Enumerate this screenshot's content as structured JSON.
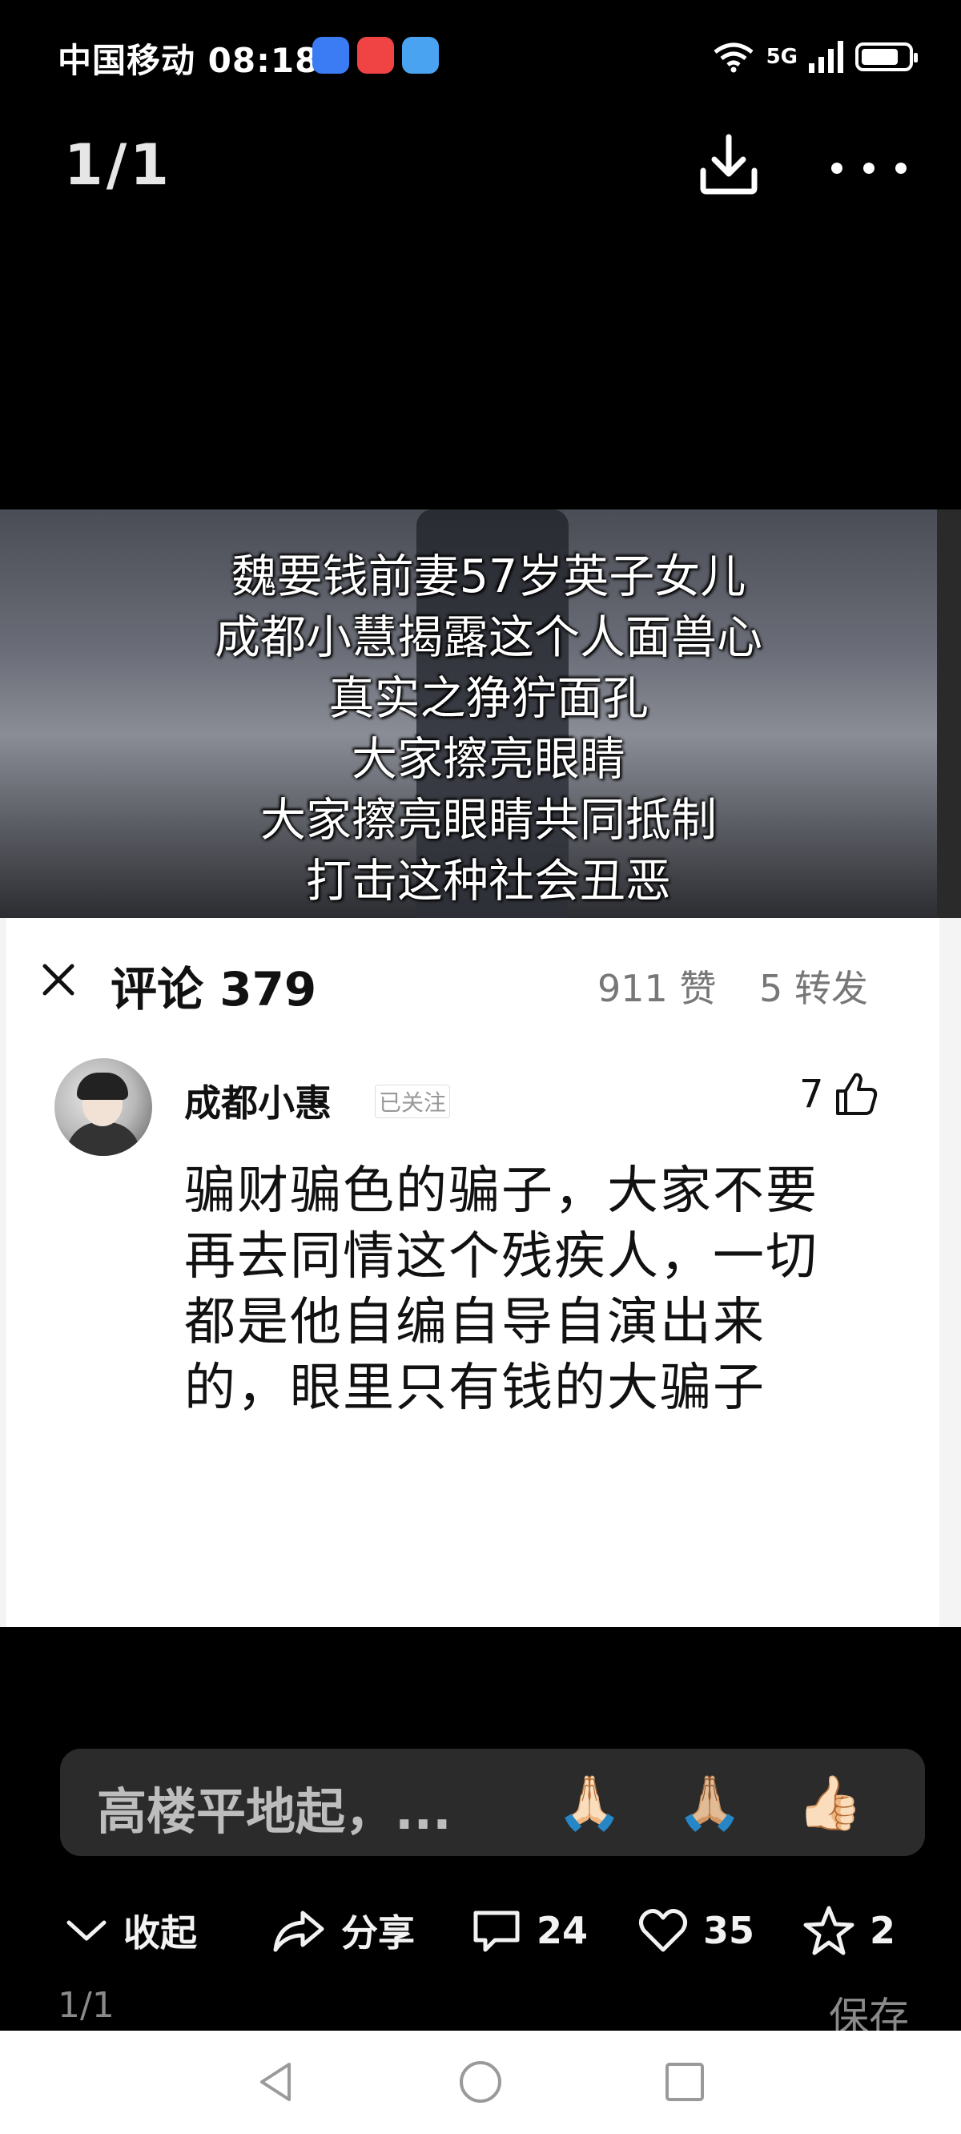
{
  "status_bar": {
    "carrier": "中国移动",
    "time": "08:18",
    "network": "5G",
    "battery_level": 0.8,
    "app_badges": [
      {
        "name": "app-market-badge",
        "color": "#3b7cf5"
      },
      {
        "name": "video-app-badge",
        "color": "#f04444"
      },
      {
        "name": "weather-app-badge",
        "color": "#4aa3f0"
      }
    ]
  },
  "top_bar": {
    "page_indicator": "1/1",
    "download_icon": "download-icon",
    "more_icon": "more-icon"
  },
  "image": {
    "caption_lines": [
      "魏要钱前妻57岁英子女儿",
      "成都小慧揭露这个人面兽心",
      "真实之狰狞面孔",
      "大家擦亮眼睛",
      "大家擦亮眼睛共同抵制",
      "打击这种社会丑恶"
    ],
    "comments_panel": {
      "title": "评论 379",
      "likes": "911 赞",
      "shares": "5 转发",
      "comment": {
        "author": "成都小惠",
        "follow_status": "已关注",
        "likes": "7",
        "text": "骗财骗色的骗子，大家不要再去同情这个残疾人，一切都是他自编自导自演出来的，眼里只有钱的大骗子"
      }
    }
  },
  "reply_box": {
    "text": "高楼平地起，...",
    "emojis": [
      "🙏🏻",
      "🙏🏼",
      "👍🏻"
    ]
  },
  "actions": {
    "collapse": "收起",
    "share": "分享",
    "comments": "24",
    "likes": "35",
    "favorites": "2"
  },
  "footer": {
    "page": "1/1",
    "save": "保存"
  },
  "nav_bar": {
    "back_icon": "back-triangle-icon",
    "home_icon": "home-circle-icon",
    "recents_icon": "recents-square-icon"
  }
}
